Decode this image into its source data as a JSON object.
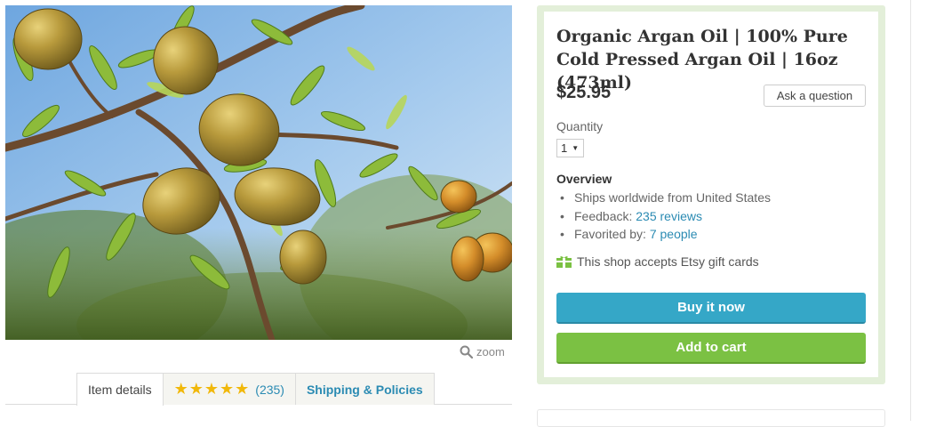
{
  "product": {
    "title": "Organic Argan Oil | 100% Pure Cold Pressed Argan Oil | 16oz (473ml)",
    "price": "$25.95",
    "image_alt_icon": "argan-fruit-photo"
  },
  "gallery": {
    "zoom_label": "zoom"
  },
  "tabs": [
    {
      "label": "Item details"
    },
    {
      "stars": "★★★★★",
      "count": "(235)"
    },
    {
      "label": "Shipping & Policies"
    }
  ],
  "actions": {
    "ask_question": "Ask a question",
    "buy_now": "Buy it now",
    "add_to_cart": "Add to cart"
  },
  "quantity": {
    "label": "Quantity",
    "selected": "1"
  },
  "overview": {
    "heading": "Overview",
    "ships": "Ships worldwide from United States",
    "feedback_label": "Feedback:",
    "feedback_link": "235 reviews",
    "favorited_label": "Favorited by:",
    "favorited_link": "7 people"
  },
  "gift_cards": "This shop accepts Etsy gift cards",
  "colors": {
    "buy_button": "#35a7c7",
    "cart_button": "#7bc143",
    "link": "#2b8bb3",
    "panel_border": "#e3efd9",
    "stars": "#f1b80a"
  }
}
